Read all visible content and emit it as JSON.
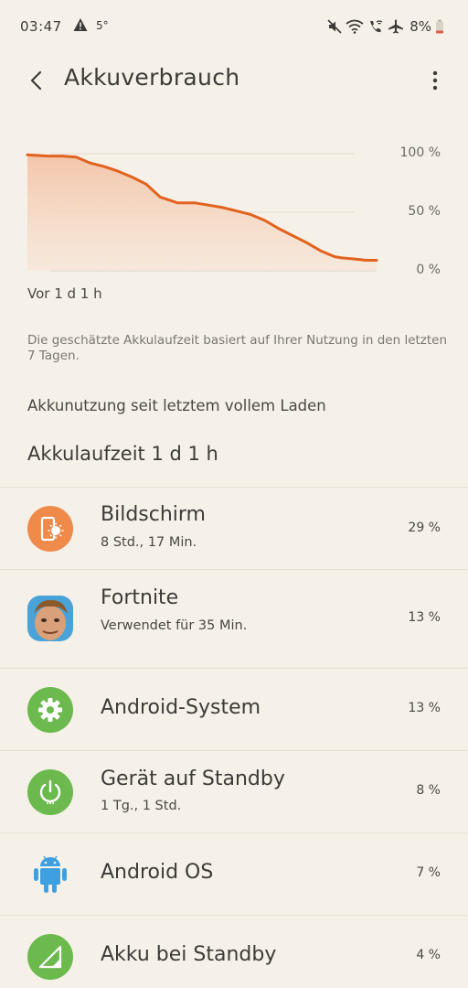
{
  "status_bar": {
    "time": "03:47",
    "temperature": "5°",
    "battery_pct": "8%",
    "icons": [
      "warning-icon",
      "mute-icon",
      "wifi-icon",
      "wifi-call-icon",
      "airplane-icon",
      "battery-icon"
    ]
  },
  "header": {
    "title": "Akkuverbrauch"
  },
  "chart_data": {
    "type": "area",
    "x": [
      0,
      0.06,
      0.1,
      0.14,
      0.18,
      0.22,
      0.26,
      0.3,
      0.34,
      0.38,
      0.41,
      0.43,
      0.48,
      0.52,
      0.56,
      0.6,
      0.64,
      0.68,
      0.72,
      0.76,
      0.8,
      0.84,
      0.88,
      0.9,
      0.94,
      0.97,
      1.0
    ],
    "values": [
      99,
      98,
      98,
      97,
      92,
      89,
      85,
      80,
      74,
      63,
      60,
      58,
      58,
      56,
      54,
      51,
      48,
      43,
      36,
      30,
      24,
      17,
      12,
      11,
      10,
      9,
      9
    ],
    "yticks": [
      "100 %",
      "50 %",
      "0 %"
    ],
    "ylim": [
      0,
      100
    ],
    "xlabel": "Vor 1 d 1 h",
    "line_color": "#e2621e",
    "fill_color": "#f5cdb6"
  },
  "note": "Die geschätzte Akkulaufzeit basiert auf Ihrer Nutzung in den letzten 7 Tagen.",
  "section_header": "Akkunutzung seit letztem vollem Laden",
  "runtime_label": "Akkulaufzeit 1 d 1 h",
  "items": [
    {
      "title": "Bildschirm",
      "subtitle": "8 Std., 17 Min.",
      "pct": "29 %",
      "icon": "screen-brightness-icon",
      "color": "#ef8a4a"
    },
    {
      "title": "Fortnite",
      "subtitle": "Verwendet für 35 Min.",
      "pct": "13 %",
      "icon": "fortnite-app-icon",
      "color": "#4aa3d8"
    },
    {
      "title": "Android-System",
      "subtitle": "",
      "pct": "13 %",
      "icon": "gear-icon",
      "color": "#6cba4e"
    },
    {
      "title": "Gerät auf Standby",
      "subtitle": "1 Tg., 1 Std.",
      "pct": "8 %",
      "icon": "power-icon",
      "color": "#6cba4e"
    },
    {
      "title": "Android OS",
      "subtitle": "",
      "pct": "7 %",
      "icon": "android-robot-icon",
      "color": "#3ea0e0"
    },
    {
      "title": "Akku bei Standby",
      "subtitle": "",
      "pct": "4 %",
      "icon": "signal-icon",
      "color": "#6cba4e"
    }
  ]
}
